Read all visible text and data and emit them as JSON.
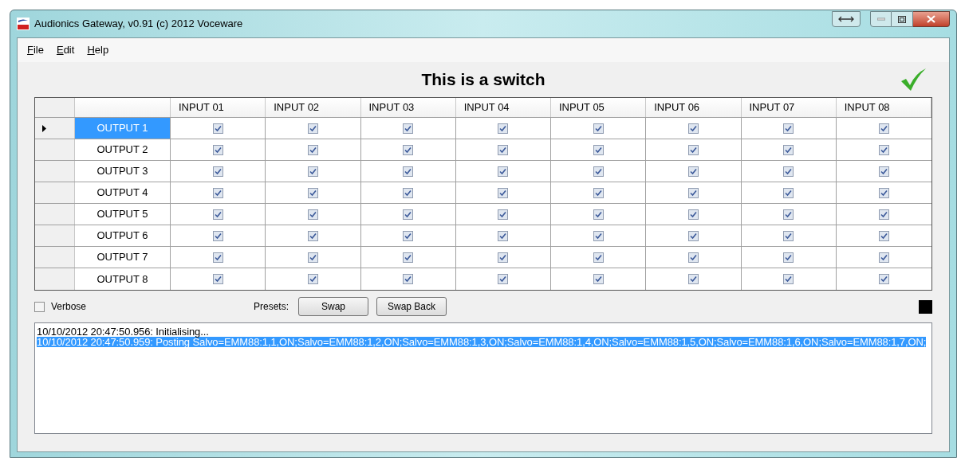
{
  "window": {
    "title": "Audionics Gateway, v0.91 (c) 2012 Voceware"
  },
  "menu": [
    "File",
    "Edit",
    "Help"
  ],
  "heading": "This is a switch",
  "grid": {
    "columns": [
      "INPUT 01",
      "INPUT 02",
      "INPUT 03",
      "INPUT 04",
      "INPUT 05",
      "INPUT 06",
      "INPUT 07",
      "INPUT 08"
    ],
    "rows": [
      {
        "label": "OUTPUT 1",
        "selected": true,
        "checked": [
          true,
          true,
          true,
          true,
          true,
          true,
          true,
          true
        ]
      },
      {
        "label": "OUTPUT 2",
        "selected": false,
        "checked": [
          true,
          true,
          true,
          true,
          true,
          true,
          true,
          true
        ]
      },
      {
        "label": "OUTPUT 3",
        "selected": false,
        "checked": [
          true,
          true,
          true,
          true,
          true,
          true,
          true,
          true
        ]
      },
      {
        "label": "OUTPUT 4",
        "selected": false,
        "checked": [
          true,
          true,
          true,
          true,
          true,
          true,
          true,
          true
        ]
      },
      {
        "label": "OUTPUT 5",
        "selected": false,
        "checked": [
          true,
          true,
          true,
          true,
          true,
          true,
          true,
          true
        ]
      },
      {
        "label": "OUTPUT 6",
        "selected": false,
        "checked": [
          true,
          true,
          true,
          true,
          true,
          true,
          true,
          true
        ]
      },
      {
        "label": "OUTPUT 7",
        "selected": false,
        "checked": [
          true,
          true,
          true,
          true,
          true,
          true,
          true,
          true
        ]
      },
      {
        "label": "OUTPUT 8",
        "selected": false,
        "checked": [
          true,
          true,
          true,
          true,
          true,
          true,
          true,
          true
        ]
      }
    ]
  },
  "verbose": {
    "label": "Verbose",
    "checked": false
  },
  "presets": {
    "label": "Presets:",
    "buttons": [
      "Swap",
      "Swap Back"
    ]
  },
  "log": [
    {
      "text": "10/10/2012 20:47:50.956: Initialising...",
      "selected": false
    },
    {
      "text": "10/10/2012 20:47:50.959: Posting Salvo=EMM88:1,1,ON;Salvo=EMM88:1,2,ON;Salvo=EMM88:1,3,ON;Salvo=EMM88:1,4,ON;Salvo=EMM88:1,5,ON;Salvo=EMM88:1,6,ON;Salvo=EMM88:1,7,ON;",
      "selected": true
    }
  ]
}
